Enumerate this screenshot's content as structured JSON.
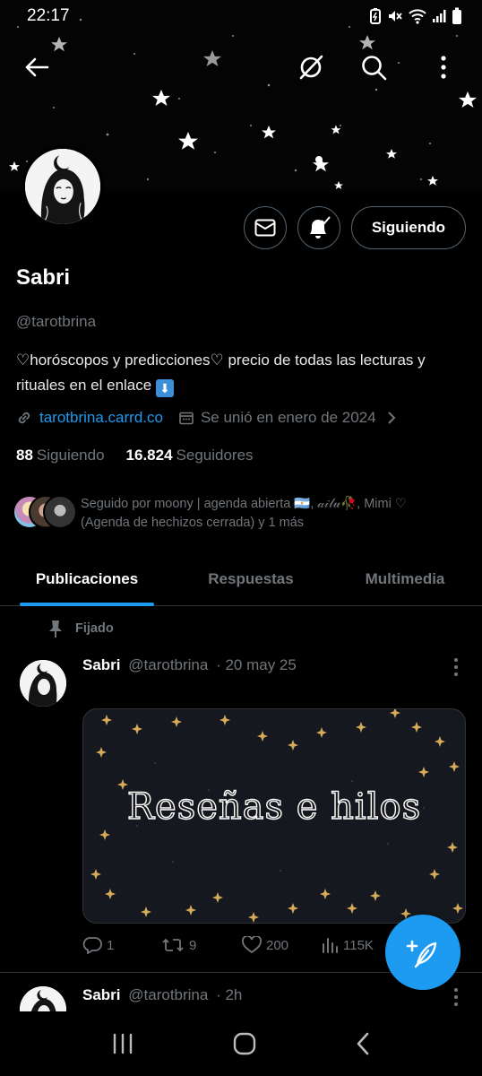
{
  "status_bar": {
    "time": "22:17"
  },
  "profile": {
    "name": "Sabri",
    "handle": "@tarotbrina",
    "bio": "♡horóscopos y predicciones♡ precio de todas las lecturas y rituales en el enlace",
    "bio_emoji": "⬇",
    "link": "tarotbrina.carrd.co",
    "joined": "Se unió en enero de 2024",
    "following_count": "88",
    "following_label": "Siguiendo",
    "followers_count": "16.824",
    "followers_label": "Seguidores",
    "followed_by": "Seguido por moony | agenda abierta 🇦🇷, 𝒶𝒾𝓁𝓊🥀, Mimi ♡ (Agenda de hechizos cerrada) y 1 más"
  },
  "actions": {
    "follow_button": "Siguiendo"
  },
  "tabs": [
    {
      "label": "Publicaciones",
      "active": true
    },
    {
      "label": "Respuestas",
      "active": false
    },
    {
      "label": "Multimedia",
      "active": false
    }
  ],
  "pinned_label": "Fijado",
  "posts": [
    {
      "name": "Sabri",
      "handle": "@tarotbrina",
      "time": "· 20 may 25",
      "media_title": "Reseñas e hilos",
      "replies": "1",
      "reposts": "9",
      "likes": "200",
      "views": "115K"
    },
    {
      "name": "Sabri",
      "handle": "@tarotbrina",
      "time": "· 2h"
    }
  ],
  "colors": {
    "accent": "#1d9bf0",
    "background": "#000000",
    "muted": "#71767b"
  }
}
